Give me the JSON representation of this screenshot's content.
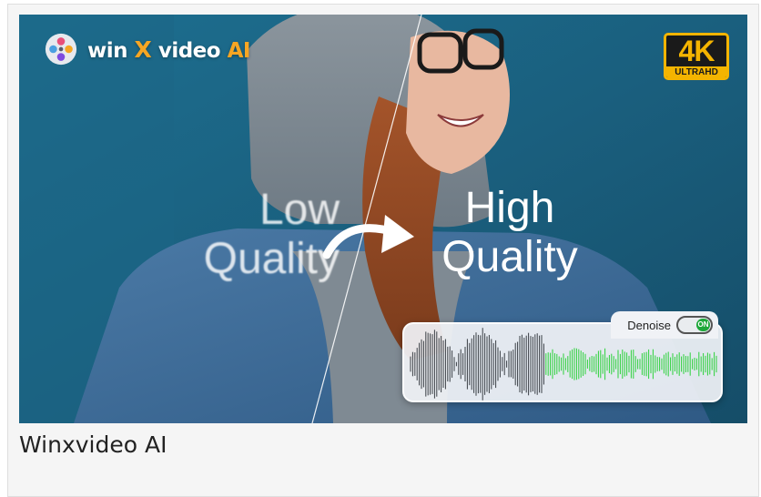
{
  "logo": {
    "name_prefix": "win",
    "name_x": "X",
    "name_mid": "video",
    "name_ai": "AI"
  },
  "badge": {
    "big": "4K",
    "strip": "ULTRAHD"
  },
  "comparison": {
    "low_line1": "Low",
    "low_line2": "Quality",
    "high_line1": "High",
    "high_line2": "Quality"
  },
  "denoise": {
    "label": "Denoise",
    "switch_state": "ON"
  },
  "caption": "Winxvideo AI",
  "colors": {
    "accent": "#f6a623",
    "badge_gold": "#f4b400",
    "switch_green": "#1ea83a",
    "wave_green": "#2bd13a"
  }
}
